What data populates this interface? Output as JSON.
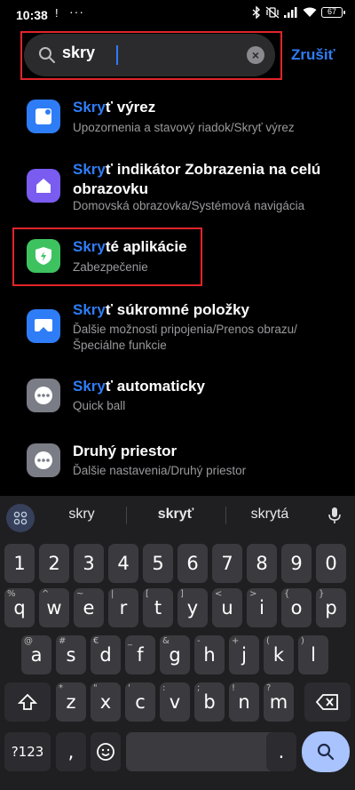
{
  "status_bar": {
    "time": "10:38",
    "notification": "!",
    "more": "···",
    "battery": "67"
  },
  "search": {
    "query": "skry",
    "cancel_label": "Zrušiť",
    "clear_symbol": "×"
  },
  "highlight_color": "#e2242b",
  "accent_color": "#2f7df6",
  "results": [
    {
      "match": "Skry",
      "rest": "ť výrez",
      "line2": "",
      "subtitle": "Upozornenia a stavový riadok/Skryť výrez",
      "subtitle2": "",
      "icon": "notch-icon",
      "icon_color": "#2f7df6"
    },
    {
      "match": "Skry",
      "rest": "ť indikátor Zobrazenia na celú",
      "line2": "obrazovku",
      "subtitle": "Domovská obrazovka/Systémová navigácia",
      "subtitle2": "",
      "icon": "home-icon",
      "icon_color": "#7a5cf0"
    },
    {
      "match": "Skry",
      "rest": "té aplikácie",
      "line2": "",
      "subtitle": "Zabezpečenie",
      "subtitle2": "",
      "icon": "shield-icon",
      "icon_color": "#3ec260"
    },
    {
      "match": "Skry",
      "rest": "ť súkromné položky",
      "line2": "",
      "subtitle": "Ďalšie možnosti pripojenia/Prenos obrazu/",
      "subtitle2": "Špeciálne funkcie",
      "icon": "cast-icon",
      "icon_color": "#2f7df6"
    },
    {
      "match": "Skry",
      "rest": "ť automaticky",
      "line2": "",
      "subtitle": "Quick ball",
      "subtitle2": "",
      "icon": "more-icon",
      "icon_color": "#7a7c86"
    },
    {
      "match": "",
      "rest": "Druhý priestor",
      "line2": "",
      "subtitle": "Ďalšie nastavenia/Druhý priestor",
      "subtitle2": "",
      "icon": "more-icon",
      "icon_color": "#7a7c86"
    }
  ],
  "keyboard": {
    "suggestions": [
      "skry",
      "skryť",
      "skrytá"
    ],
    "row_numbers": [
      "1",
      "2",
      "3",
      "4",
      "5",
      "6",
      "7",
      "8",
      "9",
      "0"
    ],
    "row1": [
      [
        "q",
        "%"
      ],
      [
        "w",
        "^"
      ],
      [
        "e",
        "~"
      ],
      [
        "r",
        "|"
      ],
      [
        "t",
        "["
      ],
      [
        "y",
        "]"
      ],
      [
        "u",
        "<"
      ],
      [
        "i",
        ">"
      ],
      [
        "o",
        "{"
      ],
      [
        "p",
        "}"
      ]
    ],
    "row2": [
      [
        "a",
        "@"
      ],
      [
        "s",
        "#"
      ],
      [
        "d",
        "€"
      ],
      [
        "f",
        "_"
      ],
      [
        "g",
        "&"
      ],
      [
        "h",
        "-"
      ],
      [
        "j",
        "+"
      ],
      [
        "k",
        "("
      ],
      [
        "l",
        ")"
      ]
    ],
    "row3": [
      [
        "z",
        "*"
      ],
      [
        "x",
        "\""
      ],
      [
        "c",
        "'"
      ],
      [
        "v",
        ":"
      ],
      [
        "b",
        ";"
      ],
      [
        "n",
        "!"
      ],
      [
        "m",
        "?"
      ]
    ],
    "symbols_label": "?123",
    "comma": ",",
    "period": "."
  }
}
